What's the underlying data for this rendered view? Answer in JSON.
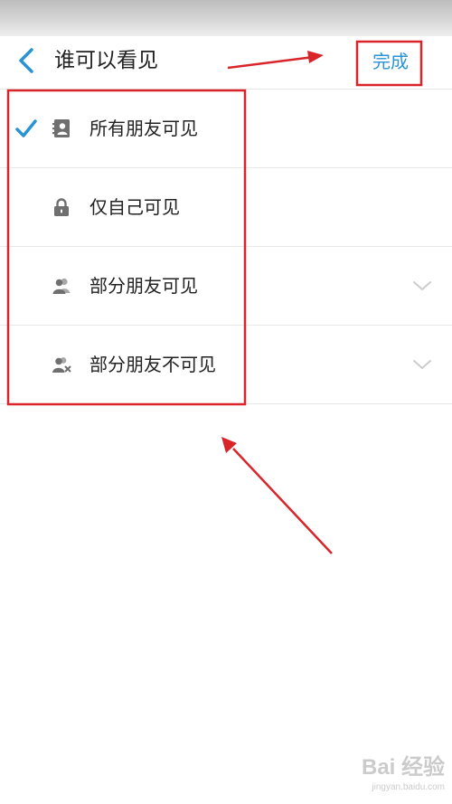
{
  "nav": {
    "title": "谁可以看见",
    "done_label": "完成"
  },
  "options": [
    {
      "label": "所有朋友可见",
      "icon": "contacts-card-icon",
      "selected": true,
      "expandable": false
    },
    {
      "label": "仅自己可见",
      "icon": "lock-icon",
      "selected": false,
      "expandable": false
    },
    {
      "label": "部分朋友可见",
      "icon": "group-icon",
      "selected": false,
      "expandable": true
    },
    {
      "label": "部分朋友不可见",
      "icon": "group-excluded-icon",
      "selected": false,
      "expandable": true
    }
  ],
  "watermark": {
    "logo": "Bai 经验",
    "url": "jingyan.baidu.com"
  },
  "colors": {
    "accent": "#2a93d5",
    "annotation": "#d9252a",
    "text": "#222222",
    "icon": "#6f6f6f",
    "divider": "#e8e8e8"
  }
}
